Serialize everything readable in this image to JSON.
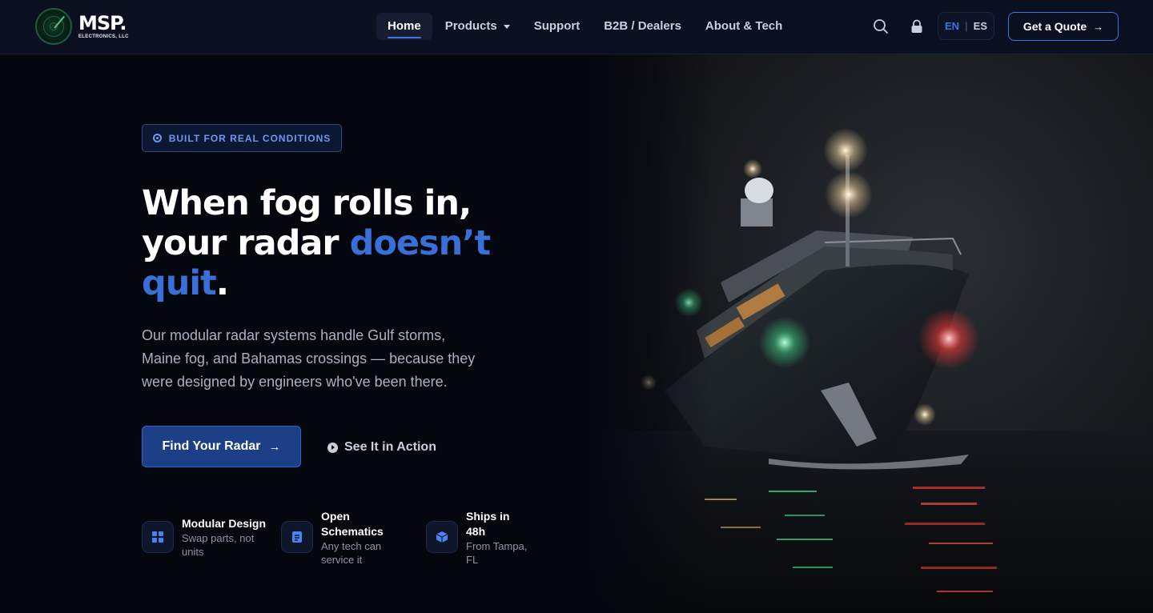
{
  "brand": {
    "name": "MSP.",
    "subtitle": "ELECTRONICS, LLC",
    "logo_icon": "radar-logo-icon"
  },
  "nav": {
    "items": [
      {
        "label": "Home",
        "active": true
      },
      {
        "label": "Products",
        "dropdown": true
      },
      {
        "label": "Support"
      },
      {
        "label": "B2B / Dealers"
      },
      {
        "label": "About & Tech"
      }
    ]
  },
  "header_actions": {
    "search_icon": "search-icon",
    "lock_icon": "lock-icon",
    "lang_active": "EN",
    "lang_other": "ES",
    "quote_label": "Get a Quote",
    "quote_arrow": "→"
  },
  "hero": {
    "badge": "BUILT FOR REAL CONDITIONS",
    "headline_line1": "When fog rolls in,",
    "headline_line2_prefix": "your radar ",
    "headline_accent": "doesn’t quit",
    "headline_end": ".",
    "subtext": "Our modular radar systems handle Gulf storms, Maine fog, and Bahamas crossings — because they were designed by engineers who've been there.",
    "primary_cta": "Find Your Radar",
    "primary_arrow": "→",
    "secondary_cta": "See It in Action",
    "image_description_icon": "ship-photo"
  },
  "features": [
    {
      "title": "Modular Design",
      "desc": "Swap parts, not units",
      "icon": "grid-icon"
    },
    {
      "title": "Open Schematics",
      "desc": "Any tech can service it",
      "icon": "document-icon"
    },
    {
      "title": "Ships in 48h",
      "desc": "From Tampa, FL",
      "icon": "cube-icon"
    }
  ],
  "colors": {
    "background": "#05070f",
    "header": "#0b1020",
    "accent": "#3b6fd8",
    "primary_button": "#1c3f87",
    "text_muted": "#a9b0c0"
  }
}
